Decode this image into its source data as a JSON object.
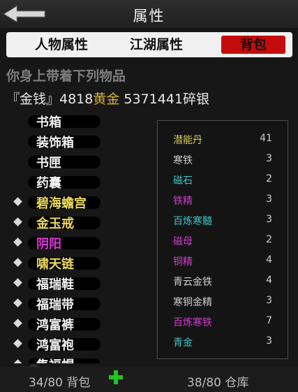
{
  "header": {
    "title": "属性"
  },
  "tabs": [
    {
      "label": "人物属性"
    },
    {
      "label": "江湖属性"
    },
    {
      "label": "背包"
    }
  ],
  "section_title": "你身上带着下列物品",
  "money": {
    "prefix": "『金钱』4818",
    "gold": "黄金",
    "rest": " 5371441碎银"
  },
  "left_items": [
    {
      "label": "书箱",
      "marked": false,
      "color": "white"
    },
    {
      "label": "装饰箱",
      "marked": false,
      "color": "white"
    },
    {
      "label": "书匣",
      "marked": false,
      "color": "white"
    },
    {
      "label": "药囊",
      "marked": false,
      "color": "white"
    },
    {
      "label": "碧海蟾宫",
      "marked": true,
      "color": "yellow"
    },
    {
      "label": "金玉戒",
      "marked": true,
      "color": "yellow"
    },
    {
      "label": "阴阳",
      "marked": true,
      "color": "magenta"
    },
    {
      "label": "啸天链",
      "marked": true,
      "color": "yellow"
    },
    {
      "label": "福瑞鞋",
      "marked": true,
      "color": "white"
    },
    {
      "label": "福瑞带",
      "marked": true,
      "color": "white"
    },
    {
      "label": "鸿富裤",
      "marked": true,
      "color": "white"
    },
    {
      "label": "鸿富袍",
      "marked": true,
      "color": "white"
    },
    {
      "label": "集福帽",
      "marked": true,
      "color": "white"
    }
  ],
  "materials": [
    {
      "name": "潜能丹",
      "count": "41",
      "color": "#d7c95a"
    },
    {
      "name": "寒铁",
      "count": "3",
      "color": "#cfcfcf"
    },
    {
      "name": "磁石",
      "count": "2",
      "color": "#3ec5c5"
    },
    {
      "name": "铁精",
      "count": "3",
      "color": "#d43ad4"
    },
    {
      "name": "百炼寒髓",
      "count": "3",
      "color": "#3ec5c5"
    },
    {
      "name": "磁母",
      "count": "2",
      "color": "#d43ad4"
    },
    {
      "name": "铜精",
      "count": "4",
      "color": "#d43ad4"
    },
    {
      "name": "青云金铁",
      "count": "4",
      "color": "#cfcfcf"
    },
    {
      "name": "寒铜金精",
      "count": "3",
      "color": "#cfcfcf"
    },
    {
      "name": "百炼寒铁",
      "count": "7",
      "color": "#d43ad4"
    },
    {
      "name": "青金",
      "count": "3",
      "color": "#3ec5c5"
    }
  ],
  "footer": {
    "bag_label": "34/80 背包",
    "warehouse_label": "38/80 仓库"
  }
}
